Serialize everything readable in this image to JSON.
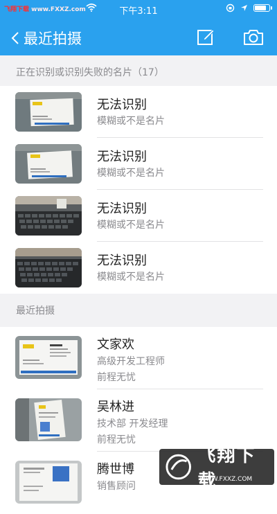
{
  "status_bar": {
    "carrier_prefix": "飞翔下载",
    "carrier_suffix": " www.FXXZ.com",
    "time": "下午3:11",
    "battery_level": 0.85
  },
  "nav": {
    "back_title": "最近拍摄",
    "icons": [
      "chevron-left-icon",
      "edit-icon",
      "camera-icon"
    ]
  },
  "failed_section": {
    "header": "正在识别或识别失败的名片（17）",
    "items": [
      {
        "name": "无法识别",
        "sub": "模糊或不是名片"
      },
      {
        "name": "无法识别",
        "sub": "模糊或不是名片"
      },
      {
        "name": "无法识别",
        "sub": "模糊或不是名片"
      },
      {
        "name": "无法识别",
        "sub": "模糊或不是名片"
      }
    ]
  },
  "recent_section": {
    "header": "最近拍摄",
    "items": [
      {
        "name": "文家欢",
        "title": "高级开发工程师",
        "company": "前程无忧"
      },
      {
        "name": "吴林进",
        "title": "技术部 开发经理",
        "company": "前程无忧"
      },
      {
        "name": "腾世博",
        "title": "销售顾问",
        "company": ""
      }
    ]
  },
  "watermark": {
    "text": "飞翔下载",
    "url": "WWW.FXXZ.COM"
  }
}
